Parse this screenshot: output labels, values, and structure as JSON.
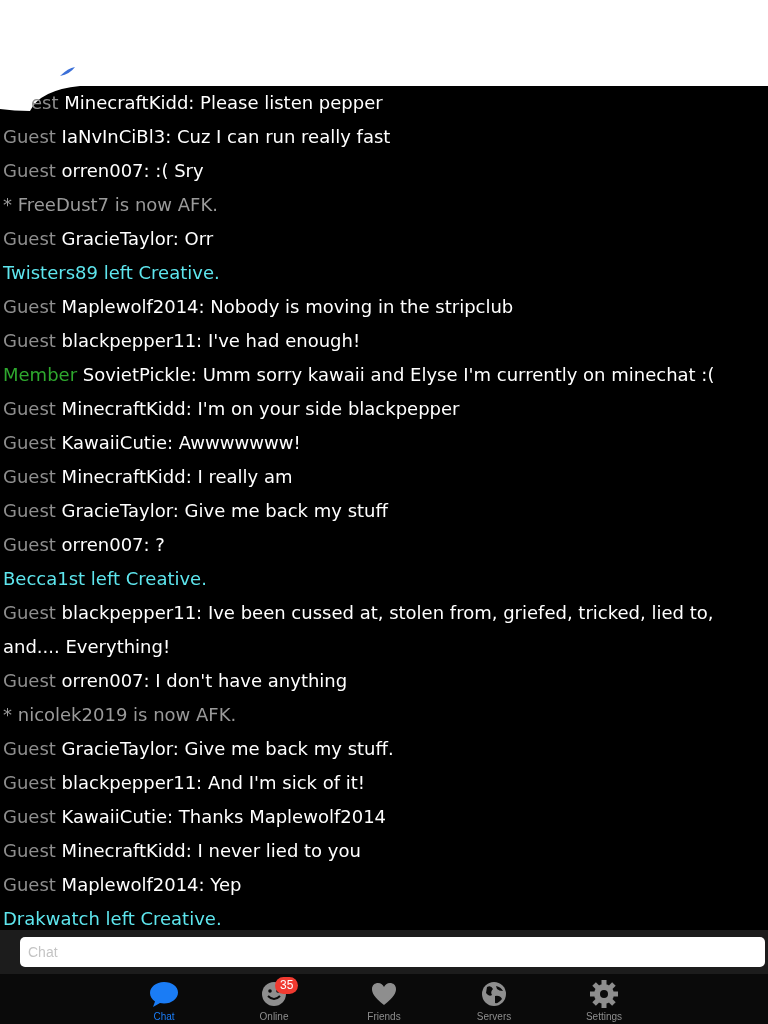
{
  "messages": [
    {
      "kind": "chat",
      "rank": "est",
      "color": "#8e8e8e",
      "text": "MinecraftKidd: Please listen pepper"
    },
    {
      "kind": "chat",
      "rank": "Guest",
      "color": "#8e8e8e",
      "text": "IaNvInCiBl3: Cuz I can run really fast"
    },
    {
      "kind": "chat",
      "rank": "Guest",
      "color": "#8e8e8e",
      "text": "orren007: :( Sry"
    },
    {
      "kind": "status",
      "text": "* FreeDust7 is now AFK."
    },
    {
      "kind": "chat",
      "rank": "Guest",
      "color": "#8e8e8e",
      "text": "GracieTaylor: Orr"
    },
    {
      "kind": "leave",
      "text": "Twisters89 left Creative."
    },
    {
      "kind": "chat",
      "rank": "Guest",
      "color": "#8e8e8e",
      "text": "Maplewolf2014: Nobody is moving in the stripclub"
    },
    {
      "kind": "chat",
      "rank": "Guest",
      "color": "#8e8e8e",
      "text": "blackpepper11: I've had enough!"
    },
    {
      "kind": "chat",
      "rank": "Member",
      "color": "#2ea82e",
      "text": "SovietPickle: Umm sorry kawaii and Elyse I'm currently on minechat :("
    },
    {
      "kind": "chat",
      "rank": "Guest",
      "color": "#8e8e8e",
      "text": "MinecraftKidd: I'm on your side blackpepper"
    },
    {
      "kind": "chat",
      "rank": "Guest",
      "color": "#8e8e8e",
      "text": "KawaiiCutie: Awwwwwww!"
    },
    {
      "kind": "chat",
      "rank": "Guest",
      "color": "#8e8e8e",
      "text": "MinecraftKidd: I really am"
    },
    {
      "kind": "chat",
      "rank": "Guest",
      "color": "#8e8e8e",
      "text": "GracieTaylor: Give me back my stuff"
    },
    {
      "kind": "chat",
      "rank": "Guest",
      "color": "#8e8e8e",
      "text": "orren007: ?"
    },
    {
      "kind": "leave",
      "text": "Becca1st left Creative."
    },
    {
      "kind": "chat",
      "rank": "Guest",
      "color": "#8e8e8e",
      "text": "blackpepper11: Ive been cussed at, stolen from, griefed, tricked, lied to, and.... Everything!"
    },
    {
      "kind": "chat",
      "rank": "Guest",
      "color": "#8e8e8e",
      "text": "orren007: I don't have anything"
    },
    {
      "kind": "status",
      "text": "* nicolek2019 is now AFK."
    },
    {
      "kind": "chat",
      "rank": "Guest",
      "color": "#8e8e8e",
      "text": "GracieTaylor: Give me back my stuff."
    },
    {
      "kind": "chat",
      "rank": "Guest",
      "color": "#8e8e8e",
      "text": "blackpepper11: And I'm sick of it!"
    },
    {
      "kind": "chat",
      "rank": "Guest",
      "color": "#8e8e8e",
      "text": "KawaiiCutie: Thanks Maplewolf2014"
    },
    {
      "kind": "chat",
      "rank": "Guest",
      "color": "#8e8e8e",
      "text": "MinecraftKidd: I never lied to you"
    },
    {
      "kind": "chat",
      "rank": "Guest",
      "color": "#8e8e8e",
      "text": "Maplewolf2014: Yep"
    },
    {
      "kind": "leave",
      "text": "Drakwatch left Creative."
    }
  ],
  "chat_input": {
    "placeholder": "Chat"
  },
  "tabs": [
    {
      "label": "Chat",
      "selected": true
    },
    {
      "label": "Online",
      "selected": false,
      "badge": "35"
    },
    {
      "label": "Friends",
      "selected": false
    },
    {
      "label": "Servers",
      "selected": false
    },
    {
      "label": "Settings",
      "selected": false
    }
  ]
}
